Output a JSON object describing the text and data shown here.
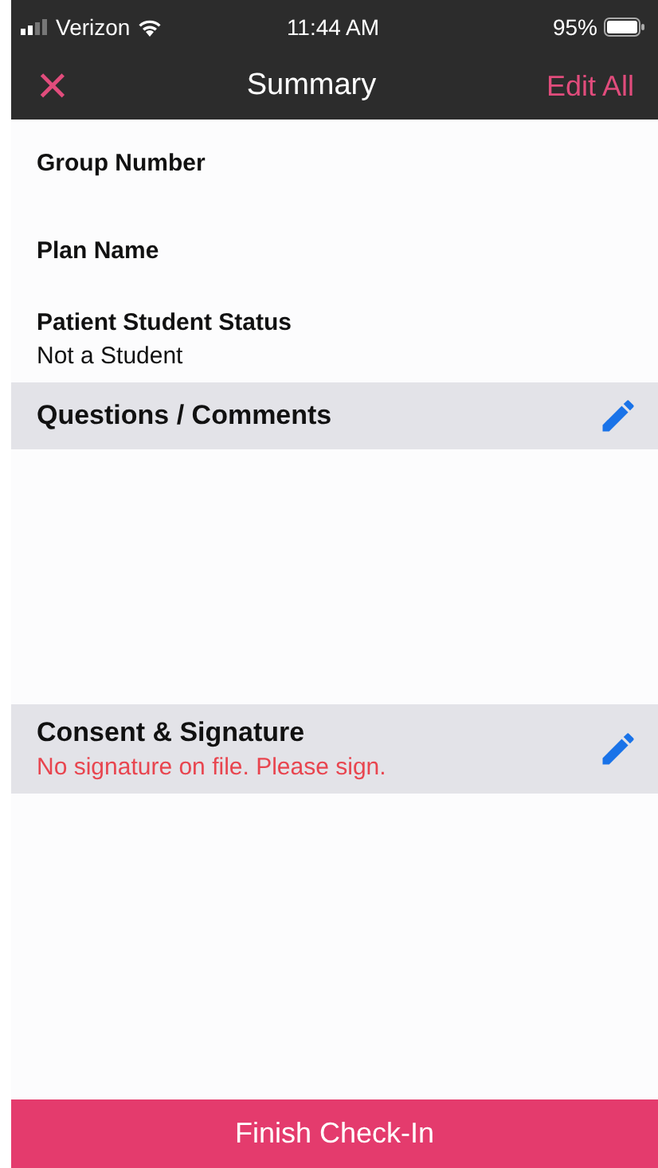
{
  "status_bar": {
    "carrier": "Verizon",
    "time": "11:44 AM",
    "battery": "95%"
  },
  "nav": {
    "close": "×",
    "title": "Summary",
    "action": "Edit All"
  },
  "fields": [
    {
      "label": "Group Number"
    },
    {
      "label": "Plan Name"
    },
    {
      "label": "Patient Student Status",
      "value": "Not a Student"
    }
  ],
  "sections": [
    {
      "title": "Questions / Comments"
    },
    {
      "title": "Consent & Signature",
      "note": "No signature on file. Please sign."
    }
  ],
  "button": "Finish Check-In"
}
